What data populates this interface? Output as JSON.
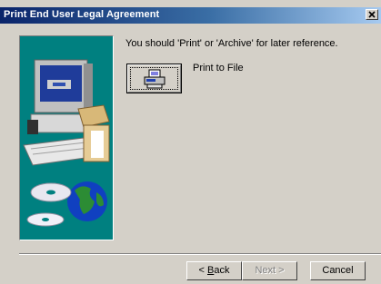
{
  "window": {
    "title": "Print End User Legal Agreement"
  },
  "message": "You should 'Print' or 'Archive' for later reference.",
  "print_option": {
    "label": "Print to File"
  },
  "buttons": {
    "back": "Back",
    "next": "Next",
    "cancel": "Cancel"
  },
  "icons": {
    "close": "close-icon",
    "print": "printer-icon",
    "side_picture": "computer-globe-illustration"
  }
}
